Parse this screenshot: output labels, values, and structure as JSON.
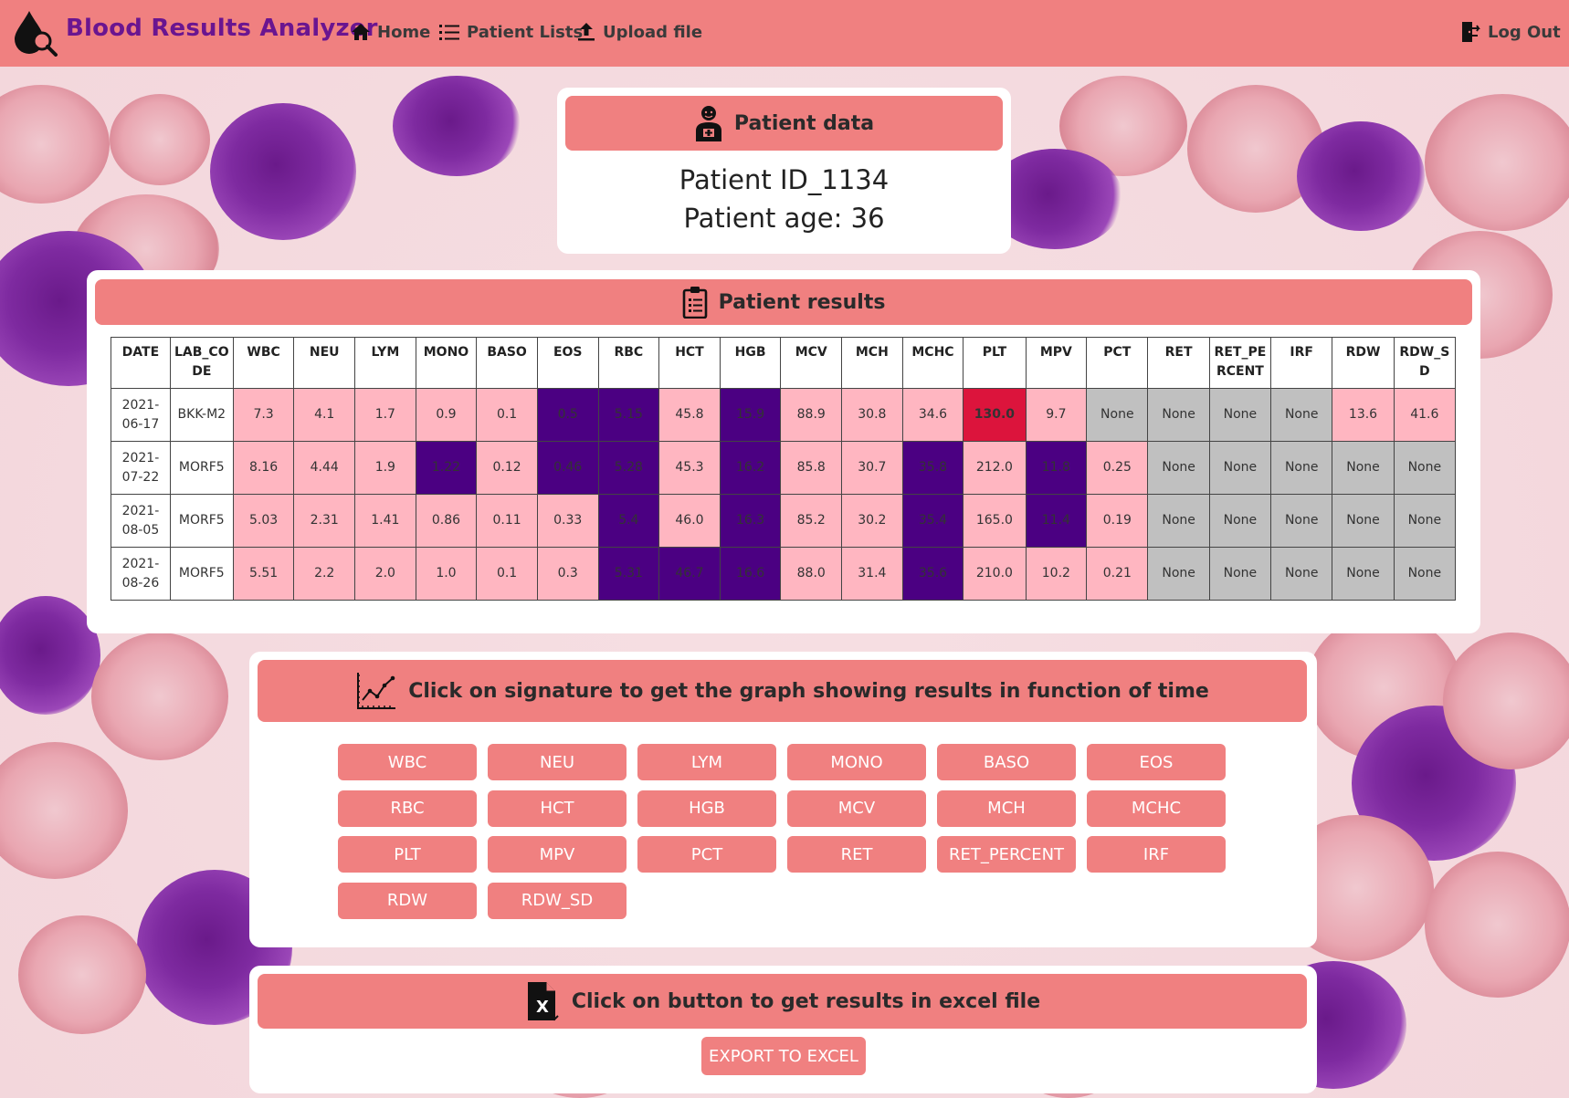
{
  "nav": {
    "brand": "Blood Results Analyzer",
    "home": "Home",
    "patient_lists": "Patient Lists",
    "upload": "Upload file",
    "logout": "Log Out"
  },
  "patient": {
    "header": "Patient data",
    "id_line": "Patient ID_1134",
    "age_line": "Patient age: 36"
  },
  "results": {
    "header": "Patient results",
    "columns": [
      "DATE",
      "LAB_CODE",
      "WBC",
      "NEU",
      "LYM",
      "MONO",
      "BASO",
      "EOS",
      "RBC",
      "HCT",
      "HGB",
      "MCV",
      "MCH",
      "MCHC",
      "PLT",
      "MPV",
      "PCT",
      "RET",
      "RET_PERCENT",
      "IRF",
      "RDW",
      "RDW_SD"
    ],
    "rows": [
      {
        "date": "2021-06-17",
        "lab": "BKK-M2",
        "values": [
          "7.3",
          "4.1",
          "1.7",
          "0.9",
          "0.1",
          "0.5",
          "5.15",
          "45.8",
          "15.9",
          "88.9",
          "30.8",
          "34.6",
          "130.0",
          "9.7",
          "None",
          "None",
          "None",
          "None",
          "13.6",
          "41.6"
        ],
        "status": [
          "p",
          "p",
          "p",
          "p",
          "p",
          "d",
          "d",
          "p",
          "d",
          "p",
          "p",
          "p",
          "r",
          "p",
          "g",
          "g",
          "g",
          "g",
          "p",
          "p"
        ]
      },
      {
        "date": "2021-07-22",
        "lab": "MORF5",
        "values": [
          "8.16",
          "4.44",
          "1.9",
          "1.22",
          "0.12",
          "0.46",
          "5.28",
          "45.3",
          "16.2",
          "85.8",
          "30.7",
          "35.8",
          "212.0",
          "11.8",
          "0.25",
          "None",
          "None",
          "None",
          "None",
          "None"
        ],
        "status": [
          "p",
          "p",
          "p",
          "d",
          "p",
          "d",
          "d",
          "p",
          "d",
          "p",
          "p",
          "d",
          "p",
          "d",
          "p",
          "g",
          "g",
          "g",
          "g",
          "g"
        ]
      },
      {
        "date": "2021-08-05",
        "lab": "MORF5",
        "values": [
          "5.03",
          "2.31",
          "1.41",
          "0.86",
          "0.11",
          "0.33",
          "5.4",
          "46.0",
          "16.3",
          "85.2",
          "30.2",
          "35.4",
          "165.0",
          "11.4",
          "0.19",
          "None",
          "None",
          "None",
          "None",
          "None"
        ],
        "status": [
          "p",
          "p",
          "p",
          "p",
          "p",
          "p",
          "d",
          "p",
          "d",
          "p",
          "p",
          "d",
          "p",
          "d",
          "p",
          "g",
          "g",
          "g",
          "g",
          "g"
        ]
      },
      {
        "date": "2021-08-26",
        "lab": "MORF5",
        "values": [
          "5.51",
          "2.2",
          "2.0",
          "1.0",
          "0.1",
          "0.3",
          "5.31",
          "46.7",
          "16.6",
          "88.0",
          "31.4",
          "35.6",
          "210.0",
          "10.2",
          "0.21",
          "None",
          "None",
          "None",
          "None",
          "None"
        ],
        "status": [
          "p",
          "p",
          "p",
          "p",
          "p",
          "p",
          "d",
          "d",
          "d",
          "p",
          "p",
          "d",
          "p",
          "p",
          "p",
          "g",
          "g",
          "g",
          "g",
          "g"
        ]
      }
    ]
  },
  "graph": {
    "header": "Click on signature to get the graph showing results in function of time",
    "buttons": [
      "WBC",
      "NEU",
      "LYM",
      "MONO",
      "BASO",
      "EOS",
      "RBC",
      "HCT",
      "HGB",
      "MCV",
      "MCH",
      "MCHC",
      "PLT",
      "MPV",
      "PCT",
      "RET",
      "RET_PERCENT",
      "IRF",
      "RDW",
      "RDW_SD"
    ]
  },
  "excel": {
    "header": "Click on button to get results in excel file",
    "button": "EXPORT TO EXCEL"
  },
  "colors": {
    "navbar": "#f08080",
    "brand": "#6a1590",
    "high": "#4b0082",
    "normal": "#ffb6c1",
    "low_critical": "#dc143c",
    "missing": "#c0c0c0"
  }
}
